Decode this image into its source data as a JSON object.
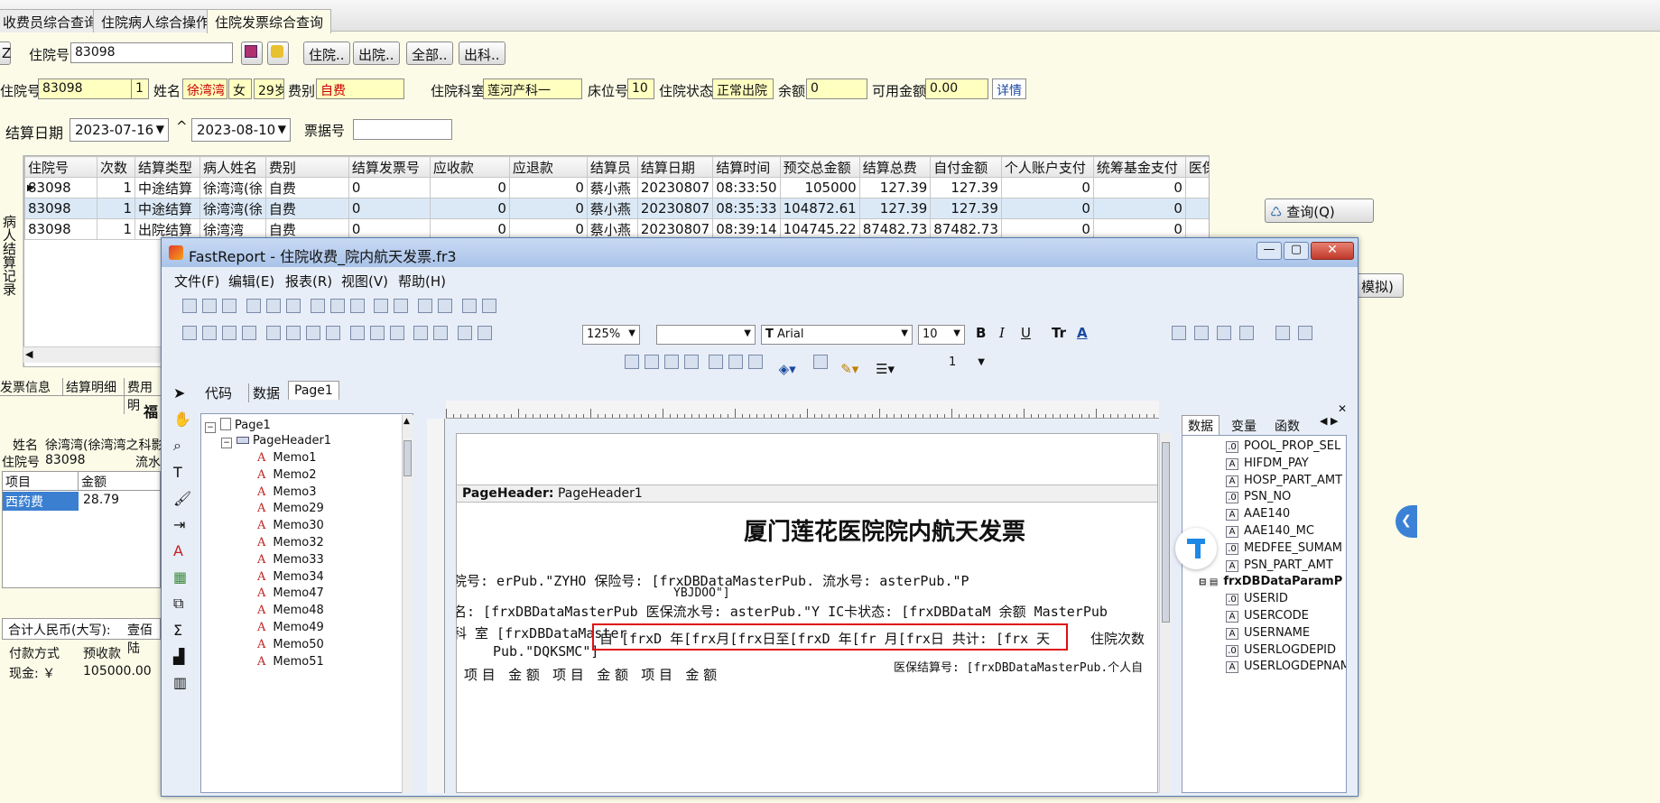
{
  "tabs": [
    "收费员综合查询",
    "住院病人综合操作",
    "住院发票综合查询"
  ],
  "top": {
    "left_btn": "Z",
    "hosp_no_label": "住院号",
    "hosp_no_value": "83098",
    "btn_admit": "住院..",
    "btn_discharge": "出院..",
    "btn_all": "全部..",
    "btn_out_dept": "出科.."
  },
  "patient": {
    "hosp_no_label": "住院号",
    "hosp_no": "83098",
    "times": "1",
    "name_label": "姓名",
    "name": "徐湾湾",
    "sex": "女",
    "age": "29岁",
    "fee_type_label": "费别",
    "fee_type": "自费",
    "dept_label": "住院科室",
    "dept": "莲河产科一",
    "bed_label": "床位号",
    "bed": "10",
    "status_label": "住院状态",
    "status": "正常出院",
    "balance_label": "余额",
    "balance": "0",
    "avail_label": "可用金额",
    "avail": "0.00",
    "detail_btn": "详情"
  },
  "filter": {
    "date_label": "结算日期",
    "date_from": "2023-07-16",
    "sep": "^",
    "date_to": "2023-08-10",
    "invoice_label": "票据号",
    "invoice_value": ""
  },
  "grid": {
    "headers": [
      "住院号",
      "次数",
      "结算类型",
      "病人姓名",
      "费别",
      "结算发票号",
      "应收款",
      "应退款",
      "结算员",
      "结算日期",
      "结算时间",
      "预交总金额",
      "结算总费",
      "自付金额",
      "个人账户支付",
      "统筹基金支付",
      "医保"
    ],
    "rows": [
      [
        "83098",
        "1",
        "中途结算",
        "徐湾湾(徐",
        "自费",
        "0",
        "0",
        "0",
        "蔡小燕",
        "20230807",
        "08:33:50",
        "105000",
        "127.39",
        "127.39",
        "0",
        "0",
        ""
      ],
      [
        "83098",
        "1",
        "中途结算",
        "徐湾湾(徐",
        "自费",
        "0",
        "0",
        "0",
        "蔡小燕",
        "20230807",
        "08:35:33",
        "104872.61",
        "127.39",
        "127.39",
        "0",
        "0",
        ""
      ],
      [
        "83098",
        "1",
        "出院结算",
        "徐湾湾",
        "自费",
        "0",
        "0",
        "0",
        "蔡小燕",
        "20230807",
        "08:39:14",
        "104745.22",
        "87482.73",
        "87482.73",
        "0",
        "0",
        ""
      ]
    ],
    "vertical_label": "病人结算记录"
  },
  "right_panel": {
    "query_btn": "查询(Q)",
    "simulate_btn": "模拟)"
  },
  "lower_left": {
    "tabs": [
      "发票信息",
      "结算明细",
      "费用明"
    ],
    "title_frag": "福",
    "name_label": "姓名",
    "name_value": "徐湾湾(徐湾湾之科影",
    "hosp_label": "住院号",
    "hosp_value": "83098",
    "serial_label": "流水",
    "col_item": "项目",
    "col_amount": "金额",
    "item_name": "西药费",
    "item_amount": "28.79",
    "total_label": "合计人民币(大写):",
    "total_value": "壹佰陆",
    "pay_method_label": "付款方式",
    "prepay_label": "预收款",
    "cash_label": "现金: ￥",
    "cash_value": "105000.00"
  },
  "fastreport": {
    "title": "FastReport - 住院收费_院内航天发票.fr3",
    "menu": [
      "文件(F)",
      "编辑(E)",
      "报表(R)",
      "视图(V)",
      "帮助(H)"
    ],
    "zoom": "125%",
    "font_name": "Arial",
    "font_size": "10",
    "line_width": "1",
    "tabs": [
      "代码",
      "数据",
      "Page1"
    ],
    "tree": [
      "Page1",
      "PageHeader1",
      "Memo1",
      "Memo2",
      "Memo3",
      "Memo29",
      "Memo30",
      "Memo32",
      "Memo33",
      "Memo34",
      "Memo47",
      "Memo48",
      "Memo49",
      "Memo50",
      "Memo51"
    ],
    "right_tabs": [
      "数据",
      "变量",
      "函数"
    ],
    "right_fields": [
      "POOL_PROP_SEL",
      "HIFDM_PAY",
      "HOSP_PART_AMT",
      "PSN_NO",
      "AAE140",
      "AAE140_MC",
      "MEDFEE_SUMAM",
      "PSN_PART_AMT",
      "frxDBDataParamP",
      "USERID",
      "USERCODE",
      "USERNAME",
      "USERLOGDEPID",
      "USERLOGDEPNAM"
    ],
    "band_label": "PageHeader:",
    "band_name": "PageHeader1",
    "report_title": "厦门莲花医院院内航天发票",
    "report_line1": "院号: erPub.\"ZYHO 保险号: [frxDBDataMasterPub. 流水号: asterPub.\"P",
    "report_line1b": "YBJDOO\"]",
    "report_line2": "名: [frxDBDataMasterPub 医保流水号: asterPub.\"Y IC卡状态: [frxDBDataM 余额 MasterPub",
    "report_line3a": "科 室 [frxDBDataMaster",
    "report_line3b": "Pub.\"DQKSMC\"]",
    "report_highlight": "自 [frxD 年[frx月[frx日至[frxD 年[fr 月[frx日 共计: [frx 天",
    "report_line3c": "住院次数",
    "report_line4": "项 目   金 额   项 目   金 额   项 目   金 额",
    "report_line4b": "医保结算号: [frxDBDataMasterPub.个人自"
  }
}
